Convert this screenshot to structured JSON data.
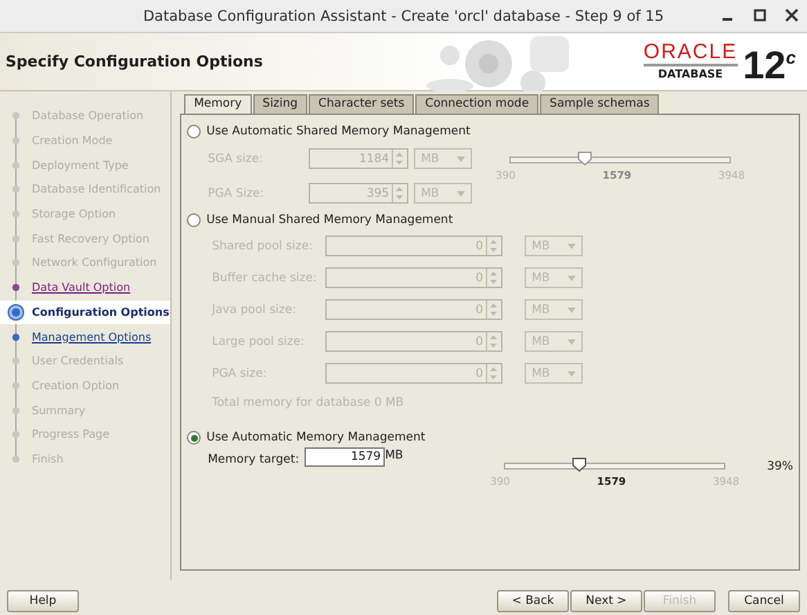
{
  "window": {
    "title": "Database Configuration Assistant - Create 'orcl' database - Step 9 of 15"
  },
  "header": {
    "title": "Specify Configuration Options",
    "logo": {
      "brand": "ORACLE",
      "product": "DATABASE",
      "version": "12$^{c}$"
    }
  },
  "steps": [
    {
      "label": "Database Operation",
      "kind": "pending",
      "selected": false
    },
    {
      "label": "Creation Mode",
      "kind": "pending",
      "selected": false
    },
    {
      "label": "Deployment Type",
      "kind": "pending",
      "selected": false
    },
    {
      "label": "Database Identification",
      "kind": "pending",
      "selected": false
    },
    {
      "label": "Storage Option",
      "kind": "pending",
      "selected": false
    },
    {
      "label": "Fast Recovery Option",
      "kind": "pending",
      "selected": false
    },
    {
      "label": "Network Configuration",
      "kind": "pending",
      "selected": false
    },
    {
      "label": "Data Vault Option",
      "kind": "visited",
      "selected": false
    },
    {
      "label": "Configuration Options",
      "kind": "current",
      "selected": true
    },
    {
      "label": "Management Options",
      "kind": "link",
      "selected": false
    },
    {
      "label": "User Credentials",
      "kind": "pending",
      "selected": false
    },
    {
      "label": "Creation Option",
      "kind": "pending",
      "selected": false
    },
    {
      "label": "Summary",
      "kind": "pending",
      "selected": false
    },
    {
      "label": "Progress Page",
      "kind": "pending",
      "selected": false
    },
    {
      "label": "Finish",
      "kind": "pending",
      "selected": false
    }
  ],
  "tabs": [
    {
      "label": "Memory",
      "selected": true
    },
    {
      "label": "Sizing",
      "selected": false
    },
    {
      "label": "Character sets",
      "selected": false
    },
    {
      "label": "Connection mode",
      "selected": false
    },
    {
      "label": "Sample schemas",
      "selected": false
    }
  ],
  "sections": [
    {
      "kind": "shared",
      "label": "Use Automatic Shared Memory Management",
      "selected": false,
      "fields": [
        {
          "label": "SGA size:",
          "value": "1184",
          "unit": "MB"
        },
        {
          "label": "PGA Size:",
          "value": "395",
          "unit": "MB"
        }
      ],
      "slider": {
        "min": "390",
        "value": "1579",
        "max": "3948",
        "level": 0.334
      }
    },
    {
      "kind": "manual",
      "label": "Use Manual Shared Memory Management",
      "selected": false,
      "fields": [
        {
          "label": "Shared pool size:",
          "value": "0",
          "unit": "MB"
        },
        {
          "label": "Buffer cache size:",
          "value": "0",
          "unit": "MB"
        },
        {
          "label": "Java pool size:",
          "value": "0",
          "unit": "MB"
        },
        {
          "label": "Large pool size:",
          "value": "0",
          "unit": "MB"
        },
        {
          "label": "PGA size:",
          "value": "0",
          "unit": "MB"
        }
      ],
      "total": "Total memory for database 0 MB"
    },
    {
      "kind": "automatic",
      "label": "Use Automatic Memory Management",
      "selected": true,
      "fields": [
        {
          "label": "Memory target:",
          "value": "1579",
          "unit": "MB"
        }
      ],
      "slider": {
        "min": "390",
        "value": "1579",
        "max": "3948",
        "level": 0.334,
        "percent": "39%"
      }
    }
  ],
  "buttons": [
    {
      "label": "Help",
      "kind": "left",
      "disabled": false
    },
    {
      "label": "< Back",
      "kind": "right",
      "disabled": false
    },
    {
      "label": "Next >",
      "kind": "right",
      "disabled": false
    },
    {
      "label": "Finish",
      "kind": "right",
      "disabled": true
    },
    {
      "label": "Cancel",
      "kind": "cancel",
      "disabled": false
    }
  ]
}
